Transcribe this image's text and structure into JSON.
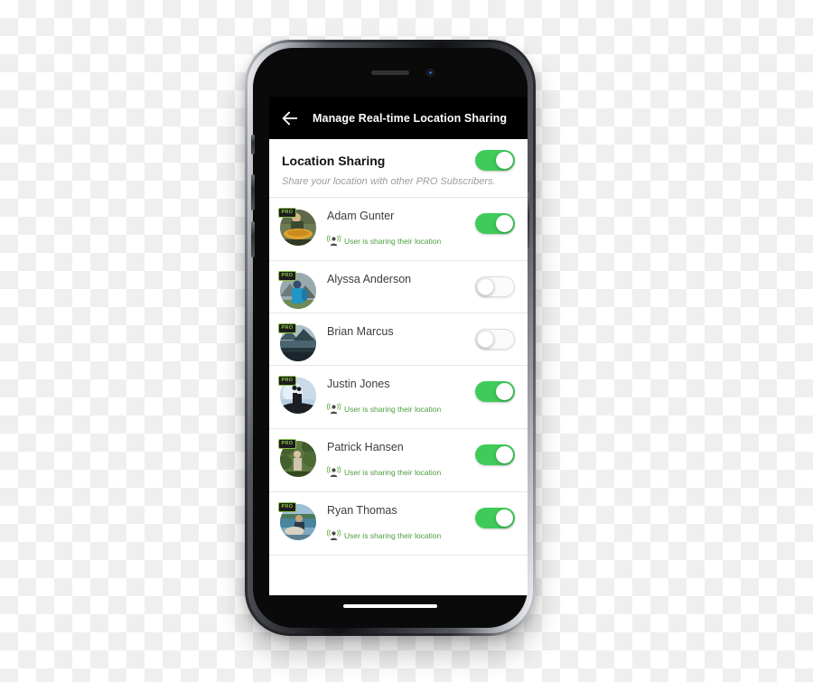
{
  "app_bar": {
    "back_icon": "back-arrow-icon",
    "title": "Manage Real-time Location Sharing"
  },
  "master_setting": {
    "label": "Location Sharing",
    "subtitle": "Share your location with other PRO Subscribers.",
    "enabled": true,
    "state_label": "On"
  },
  "badges": {
    "pro_label": "PRO"
  },
  "status": {
    "sharing_text": "User is sharing their location",
    "icon": "broadcast-person-icon"
  },
  "colors": {
    "toggle_on": "#3ecb5a",
    "toggle_off_track": "#fbfbfb",
    "status_green": "#4d9c3f",
    "pro_badge_green": "#8bc34a",
    "app_bar_bg": "#000000",
    "screen_bg": "#ffffff"
  },
  "users": [
    {
      "name": "Adam Gunter",
      "pro": true,
      "sharing": true,
      "status_text": "User is sharing their location",
      "avatar": "angler-holding-fish"
    },
    {
      "name": "Alyssa Anderson",
      "pro": true,
      "sharing": false,
      "status_text": "",
      "avatar": "hiker-blue-backpack"
    },
    {
      "name": "Brian Marcus",
      "pro": true,
      "sharing": false,
      "status_text": "",
      "avatar": "mountain-lake-landscape"
    },
    {
      "name": "Justin Jones",
      "pro": true,
      "sharing": true,
      "status_text": "User is sharing their location",
      "avatar": "couple-silhouette-on-rock"
    },
    {
      "name": "Patrick Hansen",
      "pro": true,
      "sharing": true,
      "status_text": "User is sharing their location",
      "avatar": "person-in-green-forest"
    },
    {
      "name": "Ryan Thomas",
      "pro": true,
      "sharing": true,
      "status_text": "User is sharing their location",
      "avatar": "angler-by-the-lake"
    }
  ]
}
